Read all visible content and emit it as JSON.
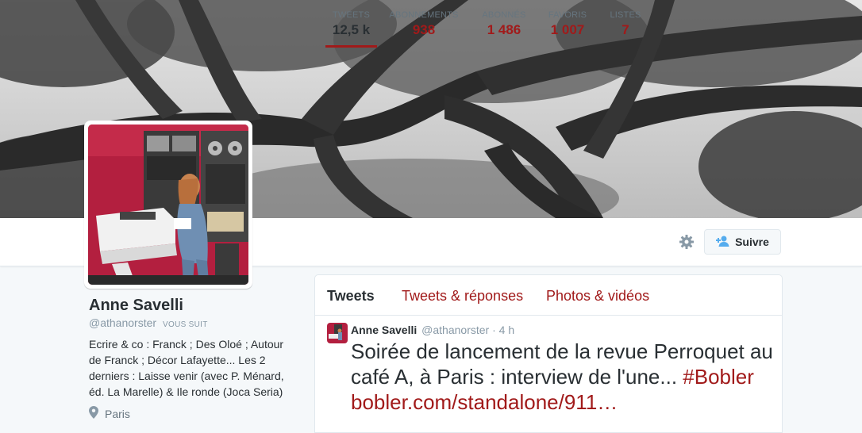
{
  "profile": {
    "name": "Anne Savelli",
    "handle": "@athanorster",
    "follows_you": "VOUS SUIT",
    "bio": "Ecrire & co : Franck ; Des Oloé ; Autour de Franck ; Décor Lafayette... Les 2 derniers : Laisse venir (avec P. Ménard, éd. La Marelle) & Ile ronde (Joca Seria)",
    "location": "Paris"
  },
  "stats": [
    {
      "label": "TWEETS",
      "value": "12,5 k"
    },
    {
      "label": "ABONNEMENTS",
      "value": "938"
    },
    {
      "label": "ABONNÉS",
      "value": "1 486"
    },
    {
      "label": "FAVORIS",
      "value": "1 007"
    },
    {
      "label": "LISTES",
      "value": "7"
    }
  ],
  "actions": {
    "follow_label": "Suivre",
    "settings_icon": "gear-icon",
    "follow_icon": "add-user-icon"
  },
  "timeline": {
    "tabs": [
      "Tweets",
      "Tweets & réponses",
      "Photos & vidéos"
    ],
    "tweet": {
      "name": "Anne Savelli",
      "handle": "@athanorster",
      "separator": "·",
      "time": "4 h",
      "text": "Soirée de lancement de la revue Perroquet au café A, à Paris : interview de l'une...",
      "hashtag": "#Bobler",
      "link": "bobler.com/standalone/911…"
    }
  },
  "colors": {
    "accent": "#a11a1a",
    "text": "#292f33",
    "muted": "#8899a6",
    "border": "#e1e8ed",
    "page_bg": "#f5f8fa"
  }
}
